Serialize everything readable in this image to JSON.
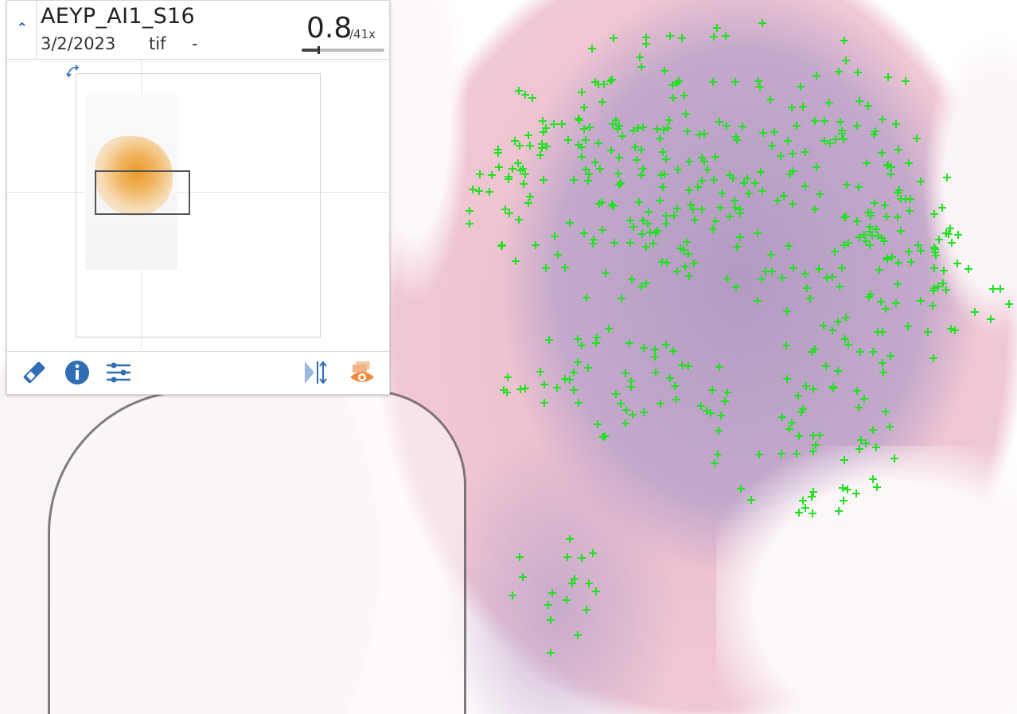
{
  "panel": {
    "slide_name": "AEYP_AI1_S16",
    "slide_date": "3/2/2023",
    "slide_format": "tif",
    "slide_extra": "-",
    "zoom": {
      "value": "0.8",
      "max_label": "/41x",
      "fraction": 0.2
    },
    "collapse_icon": "chevron-up-icon",
    "rotate_icon": "rotate-icon",
    "footer_icons": {
      "left": [
        "slide-label-icon",
        "info-icon",
        "adjustments-icon"
      ],
      "right": [
        "flip-icon",
        "visibility-icon"
      ]
    }
  },
  "colors": {
    "accent_blue": "#2f6db5",
    "marker_green": "#22e122",
    "tissue_pink": "#eab8c8",
    "tissue_purple": "#b49ac2",
    "orange_icon": "#f08a3c"
  }
}
